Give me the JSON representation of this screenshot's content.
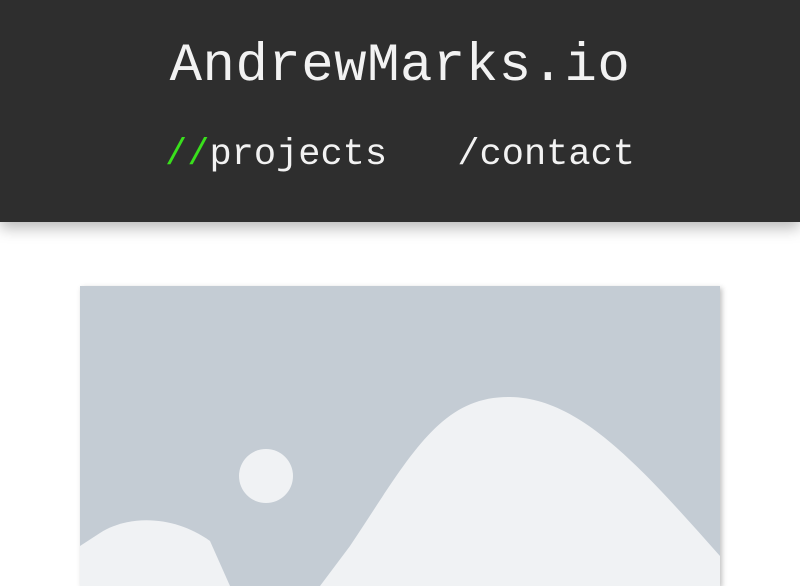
{
  "header": {
    "title": "AndrewMarks.io"
  },
  "nav": {
    "items": [
      {
        "slash": "//",
        "label": "projects",
        "active": true
      },
      {
        "slash": "/",
        "label": "contact",
        "active": false
      }
    ]
  },
  "colors": {
    "header_bg": "#2e2e2e",
    "accent": "#39e01c",
    "text": "#f2f2f2",
    "placeholder_bg": "#c4ccd4",
    "placeholder_fg": "#f0f2f4"
  },
  "main": {
    "featured_image": {
      "type": "image-placeholder"
    }
  }
}
